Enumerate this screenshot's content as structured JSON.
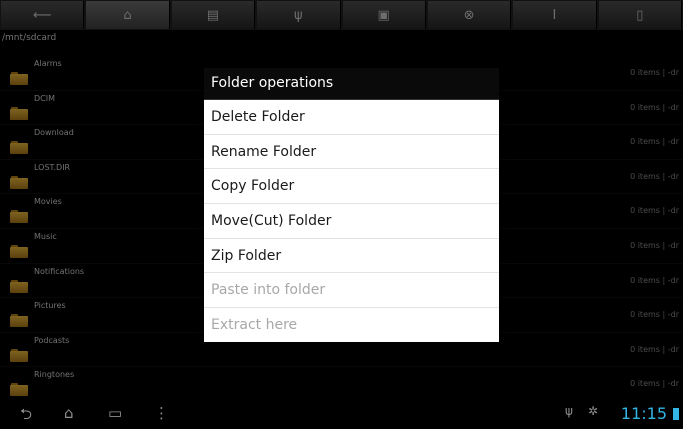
{
  "toolbar": {
    "icons": [
      "back-icon",
      "home-icon",
      "bookmark-icon",
      "usb-icon",
      "image-icon",
      "settings-icon",
      "tools-icon",
      "file-icon"
    ],
    "glyphs": [
      "⟵",
      "⌂",
      "▤",
      "ψ",
      "▣",
      "⊗",
      "I",
      "▯"
    ]
  },
  "path": "/mnt/sdcard",
  "files": [
    {
      "name": "Alarms",
      "meta": "0 items | -dr"
    },
    {
      "name": "DCIM",
      "meta": "0 items | -dr"
    },
    {
      "name": "Download",
      "meta": "0 items | -dr"
    },
    {
      "name": "LOST.DIR",
      "meta": "0 items | -dr"
    },
    {
      "name": "Movies",
      "meta": "0 items | -dr"
    },
    {
      "name": "Music",
      "meta": "0 items | -dr"
    },
    {
      "name": "Notifications",
      "meta": "0 items | -dr"
    },
    {
      "name": "Pictures",
      "meta": "0 items | -dr"
    },
    {
      "name": "Podcasts",
      "meta": "0 items | -dr"
    },
    {
      "name": "Ringtones",
      "meta": "0 items | -dr"
    }
  ],
  "dialog": {
    "title": "Folder operations",
    "items": [
      {
        "label": "Delete Folder",
        "enabled": true
      },
      {
        "label": "Rename Folder",
        "enabled": true
      },
      {
        "label": "Copy Folder",
        "enabled": true
      },
      {
        "label": "Move(Cut) Folder",
        "enabled": true
      },
      {
        "label": "Zip Folder",
        "enabled": true
      },
      {
        "label": "Paste into folder",
        "enabled": false
      },
      {
        "label": "Extract here",
        "enabled": false
      }
    ]
  },
  "status": {
    "time": "11:15",
    "accent": "#33b5e5"
  }
}
